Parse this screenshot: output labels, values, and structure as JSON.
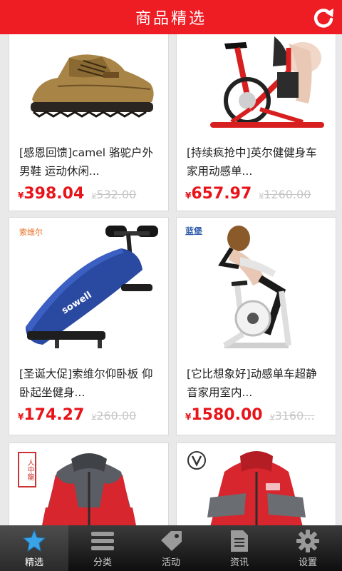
{
  "header": {
    "title": "商品精选",
    "refresh_icon": "refresh-icon"
  },
  "products": [
    {
      "name": "[感恩回馈]camel 骆驼户外男鞋 运动休闲...",
      "price": "398.04",
      "old_price": "532.00",
      "currency": "¥",
      "image": "leather-hiking-shoe"
    },
    {
      "name": "[持续疯抢中]英尔健健身车家用动感单...",
      "price": "657.97",
      "old_price": "1260.00",
      "currency": "¥",
      "image": "red-spinning-bike"
    },
    {
      "name": "[圣诞大促]索维尔仰卧板 仰卧起坐健身...",
      "price": "174.27",
      "old_price": "260.00",
      "currency": "¥",
      "image": "situp-bench",
      "brand_mark": "索维尔"
    },
    {
      "name": "[它比想象好]动感单车超静音家用室内...",
      "price": "1580.00",
      "old_price": "3160...",
      "currency": "¥",
      "image": "white-exercise-bike",
      "brand_mark": "蓝堡"
    },
    {
      "name": "",
      "price": "",
      "old_price": "",
      "currency": "",
      "image": "red-grey-jacket",
      "brand_mark": "人中龍"
    },
    {
      "name": "",
      "price": "",
      "old_price": "",
      "currency": "",
      "image": "red-grey-jacket-2"
    }
  ],
  "tabs": [
    {
      "label": "精选",
      "icon": "star-icon",
      "active": true
    },
    {
      "label": "分类",
      "icon": "list-icon",
      "active": false
    },
    {
      "label": "活动",
      "icon": "tag-icon",
      "active": false
    },
    {
      "label": "资讯",
      "icon": "document-icon",
      "active": false
    },
    {
      "label": "设置",
      "icon": "gear-icon",
      "active": false
    }
  ],
  "colors": {
    "header": "#ee1d24",
    "price": "#e8141a",
    "old_price": "#c6c6c6",
    "tabbar": "#1e1e1e"
  }
}
